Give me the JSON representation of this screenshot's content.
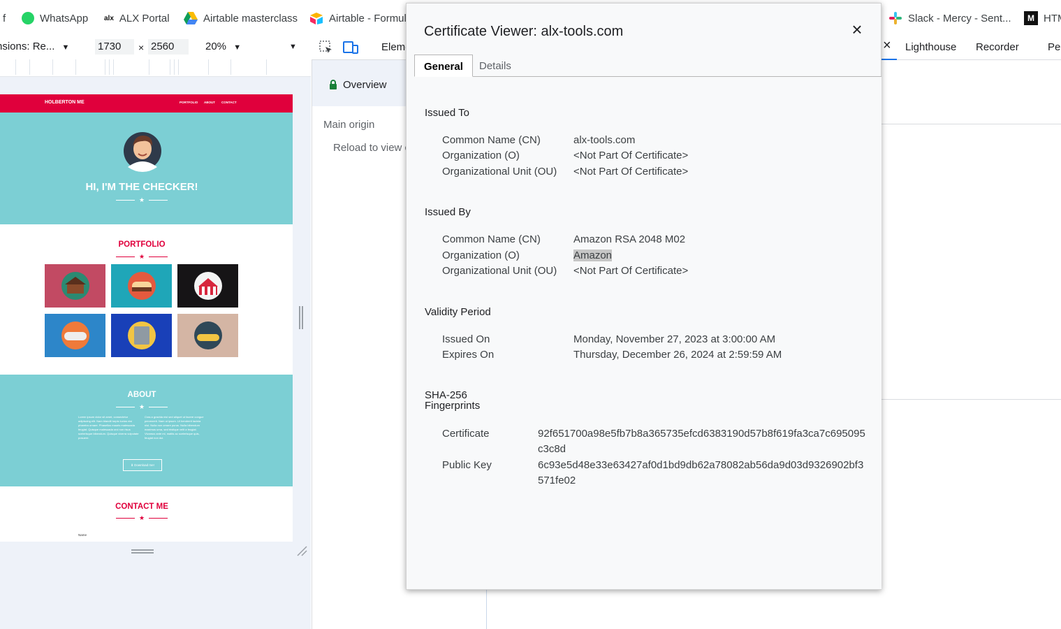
{
  "bookmarks": [
    {
      "label": "f"
    },
    {
      "label": "WhatsApp",
      "icon": "whatsapp-icon",
      "color": "#25d366"
    },
    {
      "label": "ALX Portal",
      "icon": "alx-icon"
    },
    {
      "label": "Airtable masterclass",
      "icon": "google-drive-icon"
    },
    {
      "label": "Airtable - Formul",
      "icon": "airtable-icon"
    },
    {
      "label": "Slack - Mercy - Sent...",
      "icon": "slack-icon"
    },
    {
      "label": "HTM",
      "icon": "m-logo-icon"
    }
  ],
  "device_toolbar": {
    "dimensions_label": "Dimensions: Re...",
    "width": "1730",
    "height": "2560",
    "times": "×",
    "zoom": "20%"
  },
  "emulated_page": {
    "brand": "HOLBERTON ME",
    "nav_links": [
      "PORTFOLIO",
      "ABOUT",
      "CONTACT"
    ],
    "hero_title": "HI, I'M THE CHECKER!",
    "portfolio_title": "PORTFOLIO",
    "about_title": "ABOUT",
    "about_col1": "Lorem ipsum dolor sit amet, consectetur adipiscing elit. Nam blandit turpis luctus nisi pharetra ornare. Phasellus mauris malesuada feugiat. Quisque malesuada orci non risus scelerisque bibendum. Quisque viverra vulputate posuere.",
    "about_col2": "Cras a gravida nisl sed aliquet ut facere congue pervenerit. Nam ut ipsum. Ut hendrerit lacinia nisi. Nulla non ornare purus. Nulla bibendum maximus urna, sed tristique velit a feugiat. Vivamus ante mi, mattis ac scelerisque quis, feugiat non dui.",
    "download_label": "Download me!",
    "contact_title": "CONTACT ME",
    "name_label": "Name",
    "accent": "#e0003c",
    "teal": "#7ccfd4",
    "tiles": [
      {
        "name": "cabin",
        "bg": "#c24a63",
        "circle": "#2b8a72"
      },
      {
        "name": "cake",
        "bg": "#1fa6b8",
        "circle": "#e45a3e"
      },
      {
        "name": "circus",
        "bg": "#161416",
        "circle": "#f3f3f3"
      },
      {
        "name": "game-controller",
        "bg": "#2d86c9",
        "circle": "#ef7a3a"
      },
      {
        "name": "safe",
        "bg": "#1940b8",
        "circle": "#f2c543"
      },
      {
        "name": "submarine",
        "bg": "#d4b5a4",
        "circle": "#2f4858"
      }
    ]
  },
  "devtools": {
    "elements_tab": "Eleme",
    "tabs_right": [
      "Lighthouse",
      "Recorder",
      "Per"
    ],
    "close_x": "×",
    "overview": "Overview",
    "main_origin": "Main origin",
    "reload_text": "Reload to view c"
  },
  "dialog": {
    "title": "Certificate Viewer: alx-tools.com",
    "tabs": [
      "General",
      "Details"
    ],
    "issued_to": {
      "heading": "Issued To",
      "rows": [
        {
          "label": "Common Name (CN)",
          "value": "alx-tools.com"
        },
        {
          "label": "Organization (O)",
          "value": "<Not Part Of Certificate>"
        },
        {
          "label": "Organizational Unit (OU)",
          "value": "<Not Part Of Certificate>"
        }
      ]
    },
    "issued_by": {
      "heading": "Issued By",
      "rows": [
        {
          "label": "Common Name (CN)",
          "value": "Amazon RSA 2048 M02"
        },
        {
          "label": "Organization (O)",
          "value": "Amazon"
        },
        {
          "label": "Organizational Unit (OU)",
          "value": "<Not Part Of Certificate>"
        }
      ]
    },
    "validity": {
      "heading": "Validity Period",
      "rows": [
        {
          "label": "Issued On",
          "value": "Monday, November 27, 2023 at 3:00:00 AM"
        },
        {
          "label": "Expires On",
          "value": "Thursday, December 26, 2024 at 2:59:59 AM"
        }
      ]
    },
    "fingerprints": {
      "heading_line1": "SHA-256",
      "heading_line2": "Fingerprints",
      "rows": [
        {
          "label": "Certificate",
          "value": "92f651700a98e5fb7b8a365735efcd6383190d57b8f619fa3ca7c695095c3c8d"
        },
        {
          "label": "Public Key",
          "value": "6c93e5d48e33e63427af0d1bd9db62a78082ab56da9d03d9326902bf3571fe02"
        }
      ]
    }
  }
}
